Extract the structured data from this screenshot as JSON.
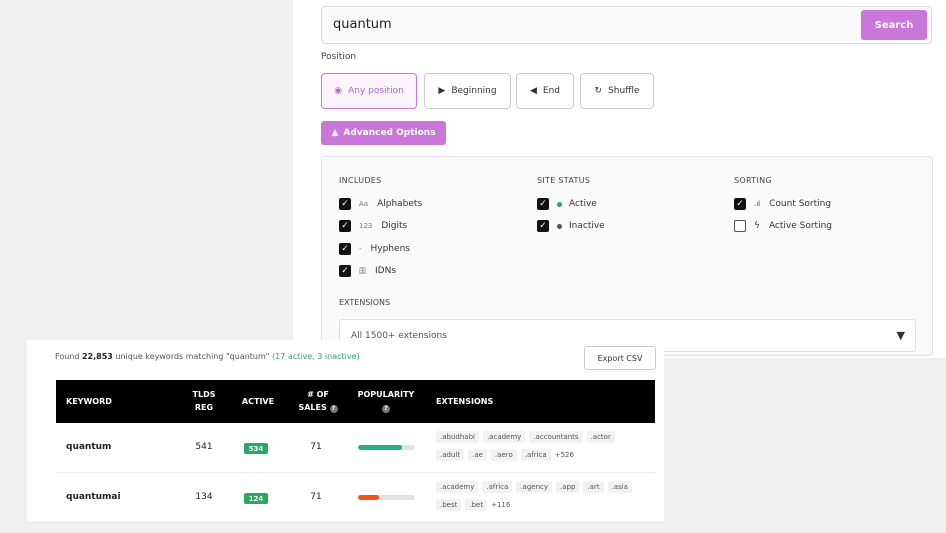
{
  "search": {
    "value": "quantum",
    "button": "Search"
  },
  "position": {
    "label": "Position",
    "options": [
      {
        "label": "Any position",
        "icon": "radio-icon"
      },
      {
        "label": "Beginning",
        "icon": "play-icon"
      },
      {
        "label": "End",
        "icon": "reverse-icon"
      },
      {
        "label": "Shuffle",
        "icon": "refresh-icon"
      }
    ]
  },
  "advanced": {
    "label": "Advanced Options"
  },
  "includes": {
    "title": "INCLUDES",
    "items": [
      {
        "prefix": "Aa",
        "label": "Alphabets",
        "checked": true
      },
      {
        "prefix": "123",
        "label": "Digits",
        "checked": true
      },
      {
        "prefix": "-",
        "label": "Hyphens",
        "checked": true
      },
      {
        "prefix": "国",
        "label": "IDNs",
        "checked": true
      }
    ]
  },
  "site_status": {
    "title": "SITE STATUS",
    "items": [
      {
        "label": "Active",
        "dot": "#27a960",
        "checked": true
      },
      {
        "label": "Inactive",
        "dot": "#555555",
        "checked": true
      }
    ]
  },
  "sorting": {
    "title": "SORTING",
    "items": [
      {
        "prefix": ".ıl",
        "label": "Count Sorting",
        "checked": true
      },
      {
        "prefix": "ϟ",
        "label": "Active Sorting",
        "checked": false
      }
    ]
  },
  "extensions": {
    "title": "EXTENSIONS",
    "selected": "All 1500+ extensions"
  },
  "results": {
    "found_prefix": "Found",
    "found_count": "22,853",
    "found_mid": "unique keywords matching \"quantum\"",
    "found_status": "(17 active, 3 inactive)",
    "export": "Export CSV",
    "headers": {
      "keyword": "KEYWORD",
      "tlds_l1": "TLDS",
      "tlds_l2": "REG",
      "active": "ACTIVE",
      "sales_l1": "# OF",
      "sales_l2": "SALES",
      "popularity": "POPULARITY",
      "extensions": "EXTENSIONS"
    },
    "rows": [
      {
        "keyword": "quantum",
        "tlds": "541",
        "active": "534",
        "sales": "71",
        "popularity": 0.78,
        "popularity_color": "#27b07a",
        "tags": [
          ".abudhabi",
          ".academy",
          ".accountants",
          ".actor",
          ".adult",
          ".ae",
          ".aero",
          ".africa"
        ],
        "more": "+526"
      },
      {
        "keyword": "quantumai",
        "tlds": "134",
        "active": "124",
        "sales": "71",
        "popularity": 0.36,
        "popularity_color": "#f0541e",
        "tags": [
          ".academy",
          ".africa",
          ".agency",
          ".app",
          ".art",
          ".asia",
          ".best",
          ".bet"
        ],
        "more": "+116"
      }
    ]
  },
  "colors": {
    "accent": "#c977d8",
    "active_green": "#27a960"
  }
}
